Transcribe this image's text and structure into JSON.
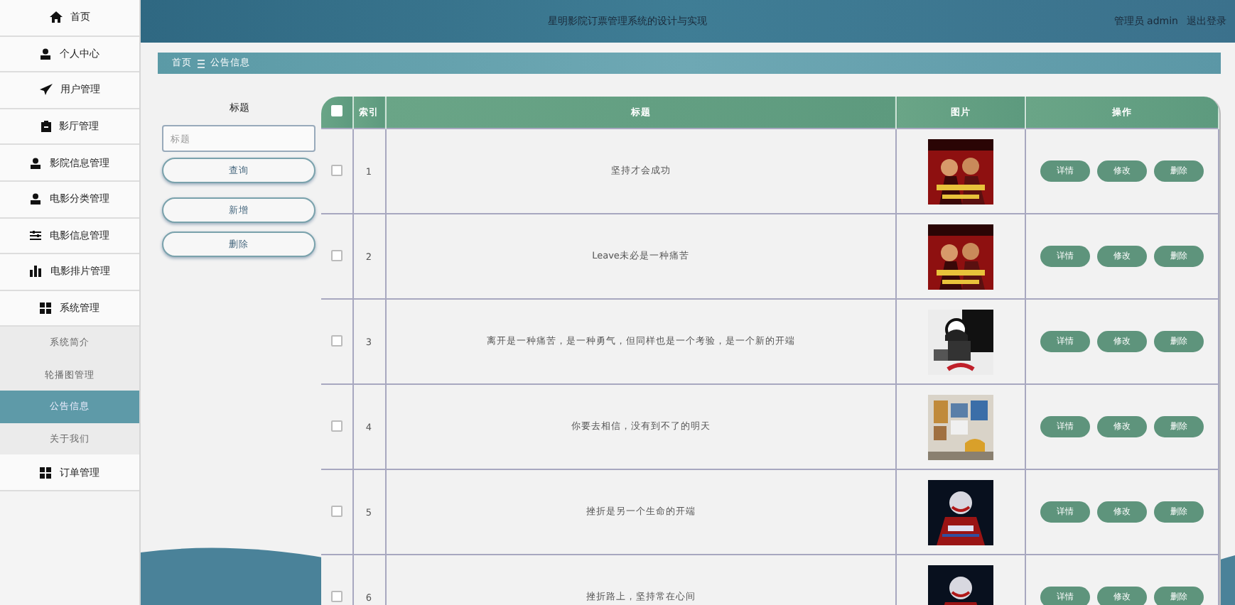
{
  "sidebar": {
    "items": [
      {
        "label": "首页",
        "selected": false
      },
      {
        "label": "个人中心",
        "selected": false
      },
      {
        "label": "用户管理",
        "selected": false
      },
      {
        "label": "影厅管理",
        "selected": false
      },
      {
        "label": "影院信息管理",
        "selected": false
      },
      {
        "label": "电影分类管理",
        "selected": false
      },
      {
        "label": "电影信息管理",
        "selected": false
      },
      {
        "label": "电影排片管理",
        "selected": false
      },
      {
        "label": "系统管理",
        "selected": false,
        "children": [
          {
            "label": "系统简介",
            "selected": false
          },
          {
            "label": "轮播图管理",
            "selected": false
          },
          {
            "label": "公告信息",
            "selected": true
          },
          {
            "label": "关于我们",
            "selected": false
          }
        ]
      },
      {
        "label": "订单管理",
        "selected": false
      }
    ]
  },
  "header": {
    "title": "星明影院订票管理系统的设计与实现",
    "user": "管理员 admin",
    "logout": "退出登录"
  },
  "breadcrumb": [
    "首页",
    "公告信息"
  ],
  "search": {
    "label": "标题",
    "placeholder": "标题",
    "buttons": [
      "查询",
      "新增",
      "删除"
    ]
  },
  "table": {
    "columns": [
      "索引",
      "标题",
      "图片",
      "操作"
    ],
    "header_checked": false,
    "rows": [
      {
        "checked": false,
        "index": "1",
        "title": "坚持才会成功",
        "actions": [
          "详情",
          "修改",
          "删除"
        ]
      },
      {
        "checked": false,
        "index": "2",
        "title": "Leave未必是一种痛苦",
        "actions": [
          "详情",
          "修改",
          "删除"
        ]
      },
      {
        "checked": false,
        "index": "3",
        "title": "离开是一种痛苦，是一种勇气，但同样也是一个考验，是一个新的开端",
        "actions": [
          "详情",
          "修改",
          "删除"
        ]
      },
      {
        "checked": false,
        "index": "4",
        "title": "你要去相信，没有到不了的明天",
        "actions": [
          "详情",
          "修改",
          "删除"
        ]
      },
      {
        "checked": false,
        "index": "5",
        "title": "挫折是另一个生命的开端",
        "actions": [
          "详情",
          "修改",
          "删除"
        ]
      },
      {
        "checked": false,
        "index": "6",
        "title": "挫折路上，坚持常在心间",
        "actions": [
          "详情",
          "修改",
          "删除"
        ]
      }
    ]
  }
}
